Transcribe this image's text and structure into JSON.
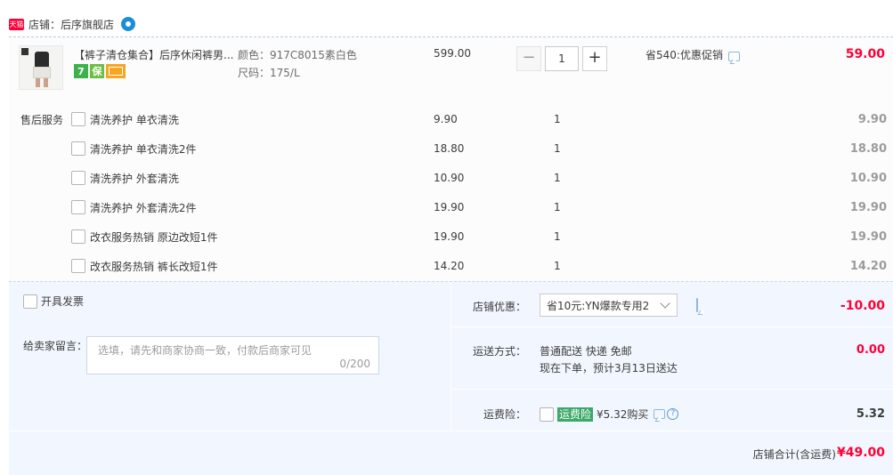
{
  "shop": {
    "badge": "天猫",
    "label": "店铺：后序旗舰店"
  },
  "product": {
    "title": "【裤子清仓集合】后序休闲裤男...",
    "tags": [
      "7",
      "保"
    ],
    "color": "颜色：917C8015素白色",
    "size": "尺码：175/L",
    "price": "599.00",
    "quantity": "1",
    "qty_minus": "−",
    "qty_plus": "+",
    "promo": "省540:优惠促销",
    "subtotal": "59.00"
  },
  "services": {
    "label": "售后服务",
    "items": [
      {
        "name": "清洗养护 单衣清洗",
        "price": "9.90",
        "qty": "1",
        "subtotal": "9.90"
      },
      {
        "name": "清洗养护 单衣清洗2件",
        "price": "18.80",
        "qty": "1",
        "subtotal": "18.80"
      },
      {
        "name": "清洗养护 外套清洗",
        "price": "10.90",
        "qty": "1",
        "subtotal": "10.90"
      },
      {
        "name": "清洗养护 外套清洗2件",
        "price": "19.90",
        "qty": "1",
        "subtotal": "19.90"
      },
      {
        "name": "改衣服务热销 原边改短1件",
        "price": "19.90",
        "qty": "1",
        "subtotal": "19.90"
      },
      {
        "name": "改衣服务热销 裤长改短1件",
        "price": "14.20",
        "qty": "1",
        "subtotal": "14.20"
      }
    ]
  },
  "invoice": {
    "label": "开具发票"
  },
  "note": {
    "label": "给卖家留言：",
    "placeholder": "选填，请先和商家协商一致，付款后商家可见",
    "count": "0/200"
  },
  "shop_discount": {
    "label": "店铺优惠：",
    "selected": "省10元:YN爆款专用2",
    "value": "-10.00"
  },
  "shipping": {
    "label": "运送方式：",
    "method": "普通配送 快递 免邮",
    "eta": "现在下单，预计3月13日送达",
    "fee": "0.00"
  },
  "insurance": {
    "label": "运费险：",
    "tag": "运费险",
    "offer": "¥5.32购买",
    "help": "?",
    "price": "5.32"
  },
  "total": {
    "label": "店铺合计(含运费)",
    "value": "¥49.00"
  },
  "colors": {
    "accent_red": "#ff0036",
    "bottom_bg": "#f2f7ff",
    "insurance_green": "#3aa866"
  }
}
